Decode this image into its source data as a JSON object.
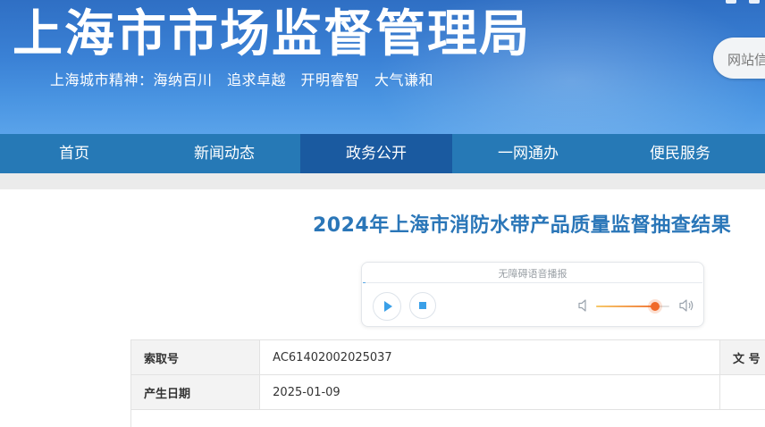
{
  "header": {
    "site_title": "上海市市场监督管理局",
    "motto": "上海城市精神：海纳百川　追求卓越　开明睿智　大气谦和",
    "search_placeholder": "网站信"
  },
  "nav": {
    "items": [
      {
        "label": "首页"
      },
      {
        "label": "新闻动态"
      },
      {
        "label": "政务公开",
        "active": true
      },
      {
        "label": "一网通办"
      },
      {
        "label": "便民服务"
      }
    ]
  },
  "article": {
    "title": "2024年上海市消防水带产品质量监督抽查结果"
  },
  "player": {
    "label": "无障碍语音播报",
    "volume": 0.8,
    "accent": "#3aa0e8"
  },
  "meta": {
    "rows": [
      {
        "label": "索取号",
        "value": "AC61402002025037",
        "label2": "文 号"
      },
      {
        "label": "产生日期",
        "value": "2025-01-09"
      }
    ]
  },
  "colors": {
    "header_blue": "#3b82d6",
    "nav_blue": "#2679b6",
    "nav_active": "#1a5aa0",
    "title_blue": "#2a76b8"
  }
}
